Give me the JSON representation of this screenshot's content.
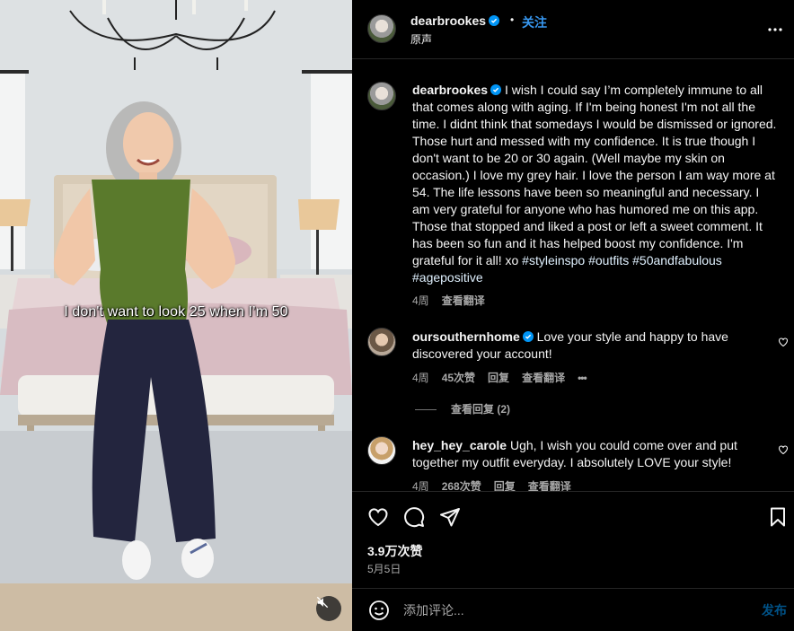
{
  "media": {
    "caption": "I don't want to look 25 when I’m 50",
    "mute_icon": "speaker-muted-icon"
  },
  "header": {
    "username": "dearbrookes",
    "separator": "•",
    "follow_label": "关注",
    "audio_label": "原声",
    "more_icon": "more-horizontal-icon"
  },
  "post_caption": {
    "username": "dearbrookes",
    "text": "I wish I could say I’m completely immune to all that comes along with aging. If I'm being honest I'm not all the time. I didnt think that somedays I would be dismissed or ignored. Those hurt and messed with my confidence. It is true though I don't want to be 20 or 30 again. (Well maybe my skin on occasion.) I love my grey hair. I love the person I am way more at 54. The life lessons have been so meaningful and necessary. I am very grateful for anyone who has humored me on this app. Those that stopped and liked a post or left a sweet comment. It has been so fun and it has helped boost my confidence. I'm grateful for it all! xo ",
    "hashtags": [
      "#styleinspo",
      "#outfits",
      "#50andfabulous",
      "#agepositive"
    ],
    "time": "4周",
    "translate_label": "查看翻译"
  },
  "comments": [
    {
      "username": "oursouthernhome",
      "verified": true,
      "text": "Love your style and happy to have discovered your account!",
      "time": "4周",
      "likes": "45次赞",
      "reply_label": "回复",
      "translate_label": "查看翻译",
      "more_label": "•••",
      "view_replies": "查看回复 (2)"
    },
    {
      "username": "hey_hey_carole",
      "verified": false,
      "text": "Ugh, I wish you could come over and put together my outfit everyday. I absolutely LOVE your style!",
      "time": "4周",
      "likes": "268次赞",
      "reply_label": "回复",
      "translate_label": "查看翻译"
    }
  ],
  "actions": {
    "like_count": "3.9万次赞",
    "date": "5月5日"
  },
  "composer": {
    "placeholder": "添加评论...",
    "post_label": "发布"
  },
  "colors": {
    "accent": "#0095f6",
    "follow": "#3797f0",
    "background": "#000000",
    "muted_text": "#a8a8a8",
    "hashtag": "#e0f1ff"
  }
}
